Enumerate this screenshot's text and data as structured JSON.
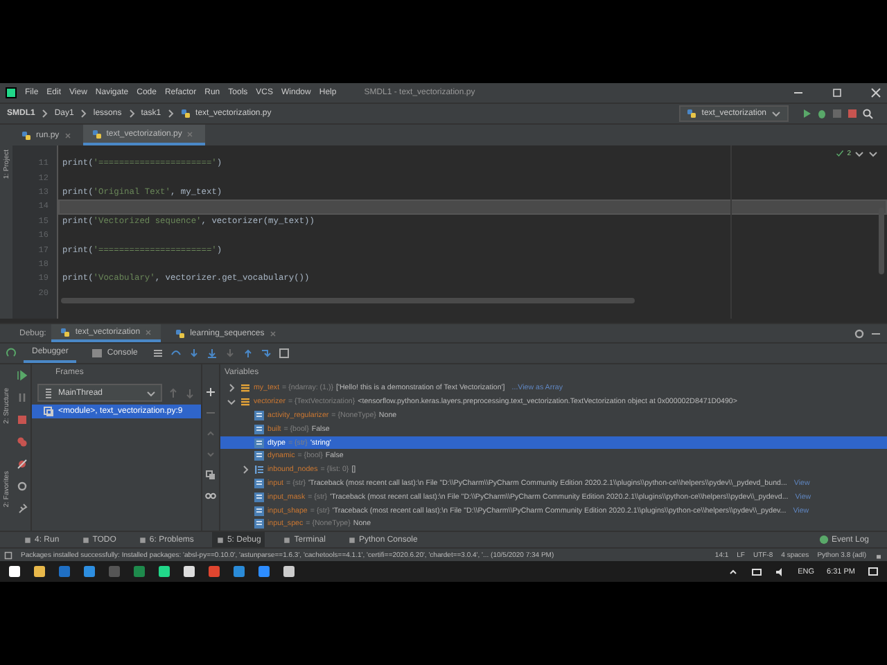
{
  "window": {
    "title": "SMDL1 - text_vectorization.py"
  },
  "menu": [
    "File",
    "Edit",
    "View",
    "Navigate",
    "Code",
    "Refactor",
    "Run",
    "Tools",
    "VCS",
    "Window",
    "Help"
  ],
  "breadcrumb": [
    "SMDL1",
    "Day1",
    "lessons",
    "task1",
    "text_vectorization.py"
  ],
  "run_config": {
    "label": "text_vectorization"
  },
  "editor_tabs": [
    {
      "label": "run.py",
      "selected": false
    },
    {
      "label": "text_vectorization.py",
      "selected": true
    }
  ],
  "left_strip": {
    "project": "1: Project",
    "structure": "2: Structure",
    "favorites": "2: Favorites"
  },
  "editor": {
    "inspection_count": "2",
    "lines": [
      {
        "number": "11",
        "current": false,
        "segments": [
          {
            "kind": "plain",
            "text": "print("
          },
          {
            "kind": "string",
            "text": "'======================'"
          },
          {
            "kind": "plain",
            "text": ")"
          }
        ]
      },
      {
        "number": "12",
        "current": false
      },
      {
        "number": "13",
        "current": false,
        "segments": [
          {
            "kind": "plain",
            "text": "print("
          },
          {
            "kind": "string",
            "text": "'Original Text'"
          },
          {
            "kind": "plain",
            "text": ", my_text)"
          }
        ]
      },
      {
        "number": "14",
        "current": true
      },
      {
        "number": "15",
        "current": false,
        "segments": [
          {
            "kind": "plain",
            "text": "print("
          },
          {
            "kind": "string",
            "text": "'Vectorized sequence'"
          },
          {
            "kind": "plain",
            "text": ", vectorizer(my_text))"
          }
        ]
      },
      {
        "number": "16",
        "current": false
      },
      {
        "number": "17",
        "current": false,
        "segments": [
          {
            "kind": "plain",
            "text": "print("
          },
          {
            "kind": "string",
            "text": "'======================'"
          },
          {
            "kind": "plain",
            "text": ")"
          }
        ]
      },
      {
        "number": "18",
        "current": false
      },
      {
        "number": "19",
        "current": false,
        "segments": [
          {
            "kind": "plain",
            "text": "print("
          },
          {
            "kind": "string",
            "text": "'Vocabulary'"
          },
          {
            "kind": "plain",
            "text": ", vectorizer.get_vocabulary())"
          }
        ]
      },
      {
        "number": "20",
        "current": false
      }
    ]
  },
  "debug": {
    "label": "Debug:",
    "sessions": [
      {
        "label": "text_vectorization",
        "selected": true
      },
      {
        "label": "learning_sequences",
        "selected": false
      }
    ],
    "tabs": [
      {
        "label": "Debugger",
        "selected": true
      },
      {
        "label": "Console",
        "selected": false
      }
    ],
    "frames": {
      "title": "Frames",
      "thread": "MainThread",
      "items": [
        {
          "label": "<module>, text_vectorization.py:9",
          "selected": true
        }
      ]
    },
    "variables": {
      "title": "Variables",
      "items": [
        {
          "name": "my_text",
          "type": "= {ndarray: (1,)}",
          "value": "['Hello! this is a demonstration of Text Vectorization']",
          "link": "...View as Array",
          "kind": "object",
          "expanded": false,
          "selected": false
        },
        {
          "name": "vectorizer",
          "type": "= {TextVectorization}",
          "value": "<tensorflow.python.keras.layers.preprocessing.text_vectorization.TextVectorization object at 0x000002D8471D0490>",
          "kind": "object",
          "expanded": true,
          "selected": false,
          "children": [
            {
              "name": "activity_regularizer",
              "type": "= {NoneType}",
              "value": "None",
              "kind": "field",
              "selected": false
            },
            {
              "name": "built",
              "type": "= {bool}",
              "value": "False",
              "kind": "field",
              "selected": false
            },
            {
              "name": "dtype",
              "type": "= {str}",
              "value": "'string'",
              "kind": "field",
              "selected": true
            },
            {
              "name": "dynamic",
              "type": "= {bool}",
              "value": "False",
              "kind": "field",
              "selected": false
            },
            {
              "name": "inbound_nodes",
              "type": "= {list: 0}",
              "value": "[]",
              "kind": "list",
              "expanded": false,
              "selected": false
            },
            {
              "name": "input",
              "type": "= {str}",
              "value": "'Traceback (most recent call last):\\n  File \"D:\\\\PyCharm\\\\PyCharm Community Edition 2020.2.1\\\\plugins\\\\python-ce\\\\helpers\\\\pydev\\\\_pydevd_bund...",
              "link": "View",
              "kind": "field",
              "selected": false
            },
            {
              "name": "input_mask",
              "type": "= {str}",
              "value": "'Traceback (most recent call last):\\n  File \"D:\\\\PyCharm\\\\PyCharm Community Edition 2020.2.1\\\\plugins\\\\python-ce\\\\helpers\\\\pydev\\\\_pydevd...",
              "link": "View",
              "kind": "field",
              "selected": false
            },
            {
              "name": "input_shape",
              "type": "= {str}",
              "value": "'Traceback (most recent call last):\\n  File \"D:\\\\PyCharm\\\\PyCharm Community Edition 2020.2.1\\\\plugins\\\\python-ce\\\\helpers\\\\pydev\\\\_pydev...",
              "link": "View",
              "kind": "field",
              "selected": false
            },
            {
              "name": "input_spec",
              "type": "= {NoneType}",
              "value": "None",
              "kind": "field",
              "selected": false
            }
          ]
        }
      ]
    }
  },
  "tool_windows": [
    {
      "label": "4: Run",
      "selected": false
    },
    {
      "label": "TODO",
      "selected": false
    },
    {
      "label": "6: Problems",
      "selected": false
    },
    {
      "label": "5: Debug",
      "selected": true
    },
    {
      "label": "Terminal",
      "selected": false
    },
    {
      "label": "Python Console",
      "selected": false
    }
  ],
  "event_log": "Event Log",
  "status_bar": {
    "message": "Packages installed successfully: Installed packages: 'absl-py==0.10.0', 'astunparse==1.6.3', 'cachetools==4.1.1', 'certifi==2020.6.20', 'chardet==3.0.4', '... (10/5/2020 7:34 PM)",
    "items": [
      "14:1",
      "LF",
      "UTF-8",
      "4 spaces",
      "Python 3.8 (adl)"
    ]
  },
  "taskbar": {
    "language": "ENG",
    "time": "6:31 PM"
  }
}
